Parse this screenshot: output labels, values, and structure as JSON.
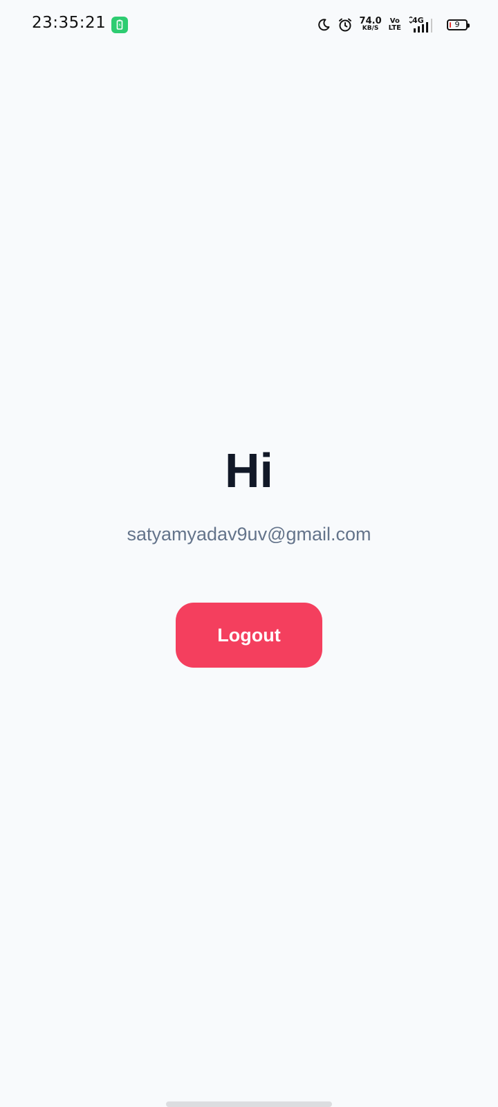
{
  "status_bar": {
    "time": "23:35:21",
    "app_badge_icon": "battery-saver-icon",
    "network_speed_value": "74.0",
    "network_speed_unit": "KB/S",
    "volte_top": "Vo",
    "volte_bottom": "LTE",
    "network_type": "4G",
    "battery_level": "9",
    "battery_fraction": 0.09,
    "icons": [
      "moon-icon",
      "alarm-icon",
      "signal-icon",
      "battery-icon"
    ]
  },
  "main": {
    "greeting": "Hi",
    "email": "satyamyadav9uv@gmail.com",
    "logout_label": "Logout"
  },
  "colors": {
    "background": "#f8fafc",
    "heading": "#111827",
    "email_text": "#64748b",
    "logout_button": "#f43f5e",
    "badge": "#2ecc71",
    "battery_low": "#e53935"
  }
}
